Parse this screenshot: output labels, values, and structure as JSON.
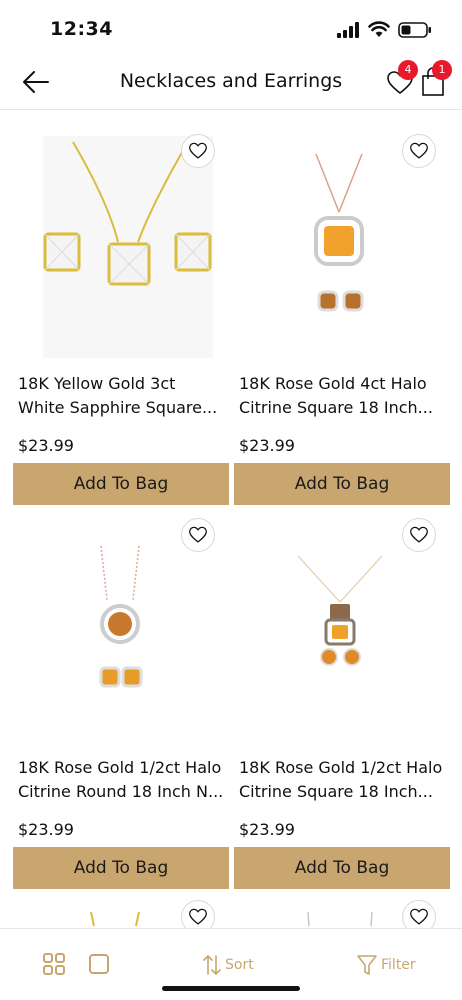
{
  "status": {
    "time": "12:34"
  },
  "header": {
    "title": "Necklaces and Earrings",
    "wishlist_count": "4",
    "bag_count": "1"
  },
  "products": [
    {
      "title_line1": "18K Yellow Gold 3ct",
      "title_line2": "White Sapphire Square...",
      "price": "$23.99",
      "button": "Add To Bag"
    },
    {
      "title_line1": "18K Rose Gold 4ct Halo",
      "title_line2": "Citrine Square 18 Inch...",
      "price": "$23.99",
      "button": "Add To Bag"
    },
    {
      "title_line1": "18K Rose Gold 1/2ct Halo",
      "title_line2": "Citrine Round 18 Inch N...",
      "price": "$23.99",
      "button": "Add To Bag"
    },
    {
      "title_line1": "18K Rose Gold 1/2ct Halo",
      "title_line2": "Citrine Square 18 Inch...",
      "price": "$23.99",
      "button": "Add To Bag"
    }
  ],
  "toolbar": {
    "sort_label": "Sort",
    "filter_label": "Filter"
  },
  "colors": {
    "accent": "#c9a670",
    "badge": "#e8192c"
  }
}
